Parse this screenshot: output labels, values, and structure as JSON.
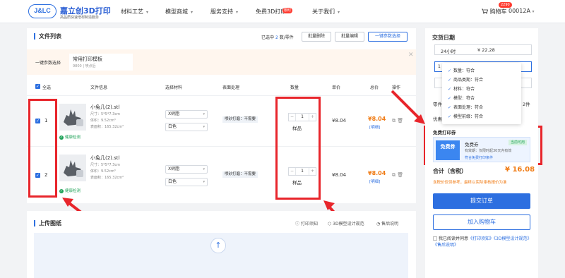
{
  "header": {
    "logo_mark": "J&LC",
    "logo_name": "嘉立创3D打印",
    "logo_sub": "高品质快速增材制造服务",
    "nav": [
      "材料工艺",
      "模型商城",
      "服务支持",
      "免费3D打印",
      "关于我们"
    ],
    "nav_badge": "限时",
    "cart_label": "购物车",
    "cart_count": "2290",
    "user": "00012A"
  },
  "files": {
    "title": "文件列表",
    "selection_prefix": "已选中",
    "selection_count": "2",
    "selection_suffix": "数/零件",
    "batch_delete": "批量删除",
    "batch_edit": "批量编辑",
    "one_click_params": "一键参数选择",
    "param_label": "一键参数选择",
    "template_name": "常用打印模板",
    "template_sub": "9800 | 喷点后",
    "columns": [
      "全选",
      "文件信息",
      "选择材料",
      "表面处理",
      "数量",
      "单价",
      "总价",
      "操作"
    ],
    "rows": [
      {
        "index": "1",
        "name": "小兔几(2).stl",
        "size": "尺寸：5*5*7.3cm",
        "volume": "体积：9.52cm³",
        "area": "表面积：165.32cm²",
        "check": "健康检测",
        "material": "X树脂",
        "color": "白色",
        "surface": "喷砂打磨：不需要",
        "qty": "1",
        "qty_label": "样品",
        "unit_price": "¥8.04",
        "total": "¥8.04",
        "detail": "[明细]"
      },
      {
        "index": "2",
        "name": "小兔几(2).stl",
        "size": "尺寸：5*5*7.3cm",
        "volume": "体积：9.52cm³",
        "area": "表面积：165.32cm²",
        "check": "健康检测",
        "material": "X树脂",
        "color": "白色",
        "surface": "喷砂打磨：不需要",
        "qty": "1",
        "qty_label": "样品",
        "unit_price": "¥8.04",
        "total": "¥8.04",
        "detail": "[明细]"
      }
    ]
  },
  "upload": {
    "title": "上传图纸",
    "links": [
      "打印须知",
      "3D模型设计规范",
      "售后说明"
    ]
  },
  "side": {
    "title": "交货日期",
    "delivery_time": "24小时",
    "delivery_price": "¥ 22.28",
    "input_prefix": "1",
    "dropdown_items": [
      "数量：符合",
      "商品类期：符合",
      "材料：符合",
      "模型：符合",
      "表面处理：符合",
      "模型前缀：符合"
    ],
    "part_label": "零件",
    "part_count": "2件",
    "discount_label": "优惠",
    "coupon_section": "免费打印券",
    "coupon_tag": "免费券",
    "coupon_name": "免费券",
    "coupon_status": "当前可用",
    "coupon_valid": "有效期：仅限时起30天内有效",
    "coupon_condition": "符合免费打印条件",
    "sum_label": "合计（含税）",
    "sum_value": "¥ 16.08",
    "note": "含税价仅供参考，最终以实际审核报价为准",
    "submit": "提交订单",
    "add_cart": "加入购物车",
    "agree_prefix": "我已阅读并同意",
    "agree_links": [
      "《打印须知》",
      "《3D模型设计规范》",
      "《售后说明》"
    ]
  },
  "colors": {
    "accent": "#2d6fe0",
    "price": "#f07b14",
    "highlight": "#e8252b",
    "success": "#21a35a"
  }
}
